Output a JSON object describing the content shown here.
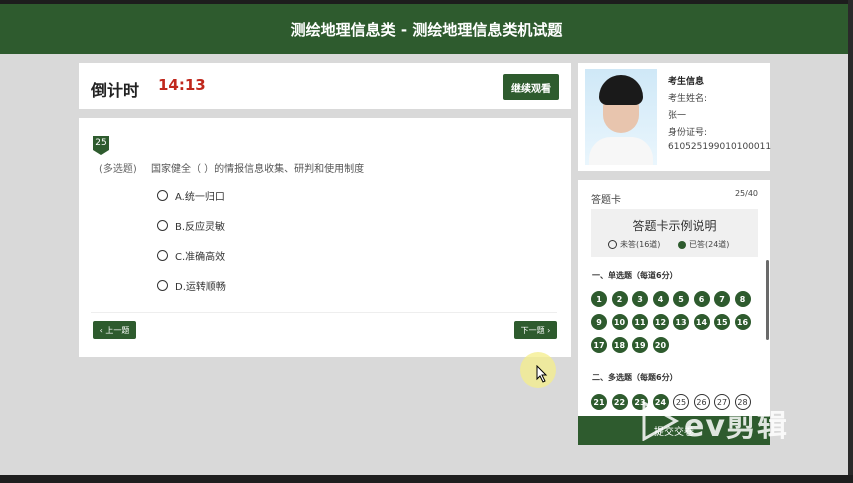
{
  "header": {
    "title": "测绘地理信息类 - 测绘地理信息类机试题"
  },
  "timer": {
    "label": "倒计时",
    "value": "14:13",
    "continue_label": "继续观看"
  },
  "question": {
    "number": "25",
    "type": "(多选题)",
    "text": "国家健全（ ）的情报信息收集、研判和使用制度",
    "options": [
      "A.统一归口",
      "B.反应灵敏",
      "C.准确高效",
      "D.运转顺畅"
    ],
    "prev_label": "‹ 上一题",
    "next_label": "下一题 ›"
  },
  "candidate": {
    "title": "考生信息",
    "name_label": "考生姓名:",
    "name_value": "张一",
    "id_label": "身份证号:",
    "id_value": "610525199010100011"
  },
  "answer_card": {
    "title": "答题卡",
    "progress": "25/40",
    "legend_title": "答题卡示例说明",
    "legend_unanswered": "未答(16道)",
    "legend_answered": "已答(24道)",
    "section1_title": "一、单选题（每道6分）",
    "section1_numbers": [
      "1",
      "2",
      "3",
      "4",
      "5",
      "6",
      "7",
      "8",
      "9",
      "10",
      "11",
      "12",
      "13",
      "14",
      "15",
      "16",
      "17",
      "18",
      "19",
      "20"
    ],
    "section2_title": "二、多选题（每题6分）",
    "section2_numbers": [
      "21",
      "22",
      "23",
      "24",
      "25",
      "26",
      "27",
      "28"
    ],
    "section2_answered": [
      true,
      true,
      true,
      true,
      false,
      false,
      false,
      false
    ]
  },
  "submit_label": "提交交卷",
  "watermark": "ev剪辑",
  "colors": {
    "header": "#2e5b2e",
    "timer": "#c0271c",
    "background": "#d9d9d9"
  }
}
